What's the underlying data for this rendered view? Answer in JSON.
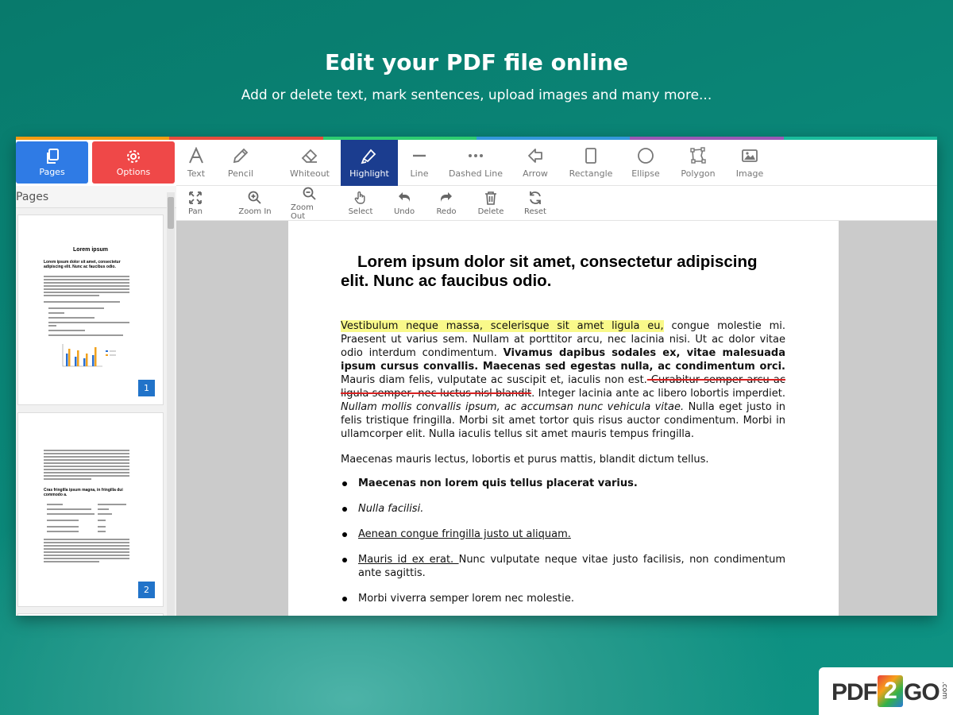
{
  "hero": {
    "title": "Edit your PDF file online",
    "subtitle": "Add or delete text, mark sentences, upload images and many more..."
  },
  "colors": {
    "top_bar": [
      "#f39c12",
      "#e74c3c",
      "#2ecc71",
      "#3498db",
      "#9b59b6",
      "#1abc9c"
    ],
    "pages_tab": "#2f7be5",
    "options_tab": "#ef4848",
    "active_tool": "#1b3d8f",
    "highlight": "#f9f98a",
    "strike": "#d82020"
  },
  "left_tabs": {
    "pages": {
      "label": "Pages",
      "icon": "copy-icon"
    },
    "options": {
      "label": "Options",
      "icon": "gear-icon"
    }
  },
  "toolbar": [
    {
      "label": "Text",
      "icon": "text-icon"
    },
    {
      "label": "Pencil",
      "icon": "pencil-icon"
    },
    {
      "label": "Whiteout",
      "icon": "eraser-icon"
    },
    {
      "label": "Highlight",
      "icon": "highlighter-icon",
      "active": true
    },
    {
      "label": "Line",
      "icon": "line-icon"
    },
    {
      "label": "Dashed Line",
      "icon": "dashed-line-icon"
    },
    {
      "label": "Arrow",
      "icon": "arrow-icon"
    },
    {
      "label": "Rectangle",
      "icon": "rectangle-icon"
    },
    {
      "label": "Ellipse",
      "icon": "ellipse-icon"
    },
    {
      "label": "Polygon",
      "icon": "polygon-icon"
    },
    {
      "label": "Image",
      "icon": "image-icon"
    }
  ],
  "toolbar2": [
    {
      "label": "Pan",
      "icon": "pan-icon"
    },
    {
      "label": "Zoom In",
      "icon": "zoom-in-icon"
    },
    {
      "label": "Zoom Out",
      "icon": "zoom-out-icon"
    },
    {
      "label": "Select",
      "icon": "hand-pointer-icon"
    },
    {
      "label": "Undo",
      "icon": "undo-icon"
    },
    {
      "label": "Redo",
      "icon": "redo-icon"
    },
    {
      "label": "Delete",
      "icon": "trash-icon"
    },
    {
      "label": "Reset",
      "icon": "refresh-icon"
    }
  ],
  "sidebar": {
    "header": "Pages",
    "thumbnails": [
      {
        "number": "1",
        "title": "Lorem ipsum",
        "heading": "Lorem ipsum dolor sit amet, consectetur adipiscing elit. Nunc ac faucibus odio."
      },
      {
        "number": "2",
        "heading": "Cras fringilla ipsum magna, in fringilla dui commodo a."
      }
    ]
  },
  "document": {
    "heading": "Lorem ipsum dolor sit amet, consectetur adipiscing elit. Nunc ac faucibus odio.",
    "p1_highlight": "Vestibulum neque massa, scelerisque sit amet ligula eu,",
    "p1_a": " congue molestie mi. Praesent ut varius sem. Nullam at porttitor arcu, nec lacinia nisi. Ut ac dolor vitae odio interdum condimentum. ",
    "p1_bold": "Vivamus dapibus sodales ex, vitae malesuada ipsum cursus convallis. Maecenas sed egestas nulla, ac condimentum orci.",
    "p1_b": " Mauris diam felis, vulputate ac suscipit et, iaculis non est.",
    "p1_strike": " Curabitur semper arcu ac ligula semper, nec luctus nisl blandit",
    "p1_c": ". Integer lacinia ante ac libero lobortis imperdiet. ",
    "p1_italic": "Nullam mollis convallis ipsum, ac accumsan nunc vehicula vitae.",
    "p1_d": " Nulla eget justo in felis tristique fringilla. Morbi sit amet tortor quis risus auctor condimentum. Morbi in ullamcorper elit. Nulla iaculis tellus sit amet mauris tempus fringilla.",
    "p2": "Maecenas mauris lectus, lobortis et purus mattis, blandit dictum tellus.",
    "list": {
      "item1": "Maecenas non lorem quis tellus placerat varius.",
      "item2": "Nulla facilisi.",
      "item3": "Aenean congue fringilla justo ut aliquam. ",
      "item4_u": "Mauris id ex erat. ",
      "item4_rest": "Nunc vulputate neque vitae justo facilisis, non condimentum ante sagittis.",
      "item5": "Morbi viverra semper lorem nec molestie."
    }
  },
  "logo": {
    "left": "PDF",
    "mid": "2",
    "right": "GO",
    "suffix": ".com"
  }
}
